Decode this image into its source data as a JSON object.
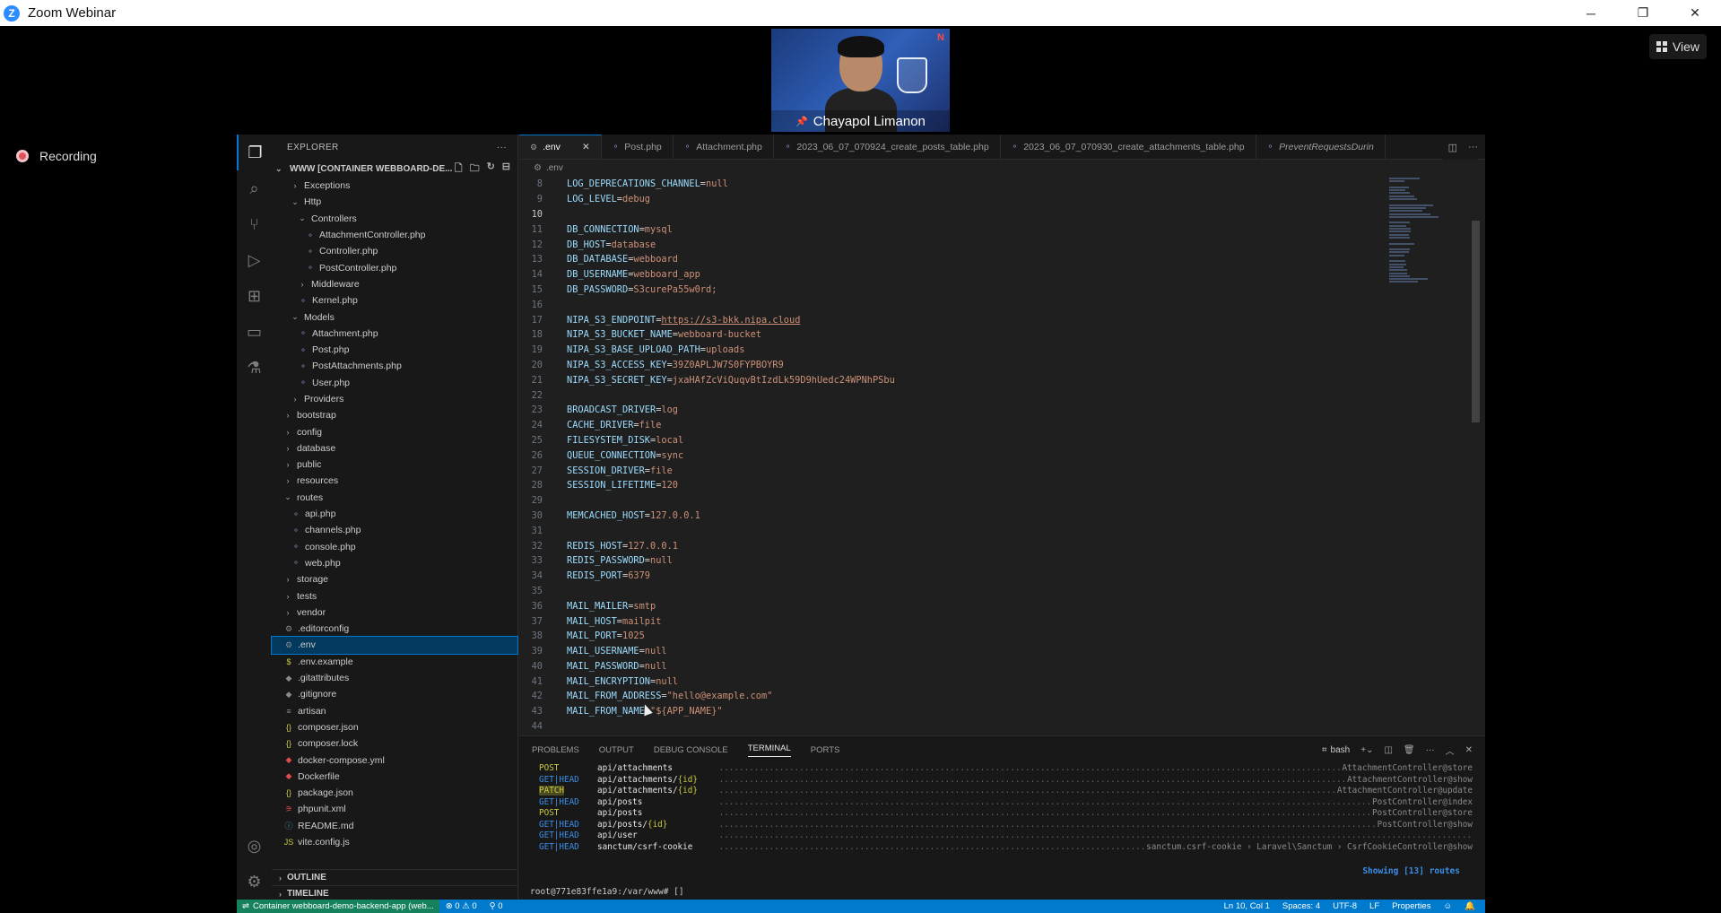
{
  "zoom": {
    "title": "Zoom Webinar",
    "view_label": "View",
    "recording_label": "Recording",
    "participant_name": "Chayapol Limanon"
  },
  "sidebar": {
    "header": "EXPLORER",
    "workspace": "WWW [CONTAINER WEBBOARD-DE...",
    "items": [
      {
        "label": "Exceptions",
        "indent": 2,
        "type": "folder",
        "open": false
      },
      {
        "label": "Http",
        "indent": 2,
        "type": "folder",
        "open": true
      },
      {
        "label": "Controllers",
        "indent": 3,
        "type": "folder",
        "open": true
      },
      {
        "label": "AttachmentController.php",
        "indent": 4,
        "type": "php"
      },
      {
        "label": "Controller.php",
        "indent": 4,
        "type": "php"
      },
      {
        "label": "PostController.php",
        "indent": 4,
        "type": "php"
      },
      {
        "label": "Middleware",
        "indent": 3,
        "type": "folder",
        "open": false
      },
      {
        "label": "Kernel.php",
        "indent": 3,
        "type": "php"
      },
      {
        "label": "Models",
        "indent": 2,
        "type": "folder",
        "open": true
      },
      {
        "label": "Attachment.php",
        "indent": 3,
        "type": "php"
      },
      {
        "label": "Post.php",
        "indent": 3,
        "type": "php"
      },
      {
        "label": "PostAttachments.php",
        "indent": 3,
        "type": "php"
      },
      {
        "label": "User.php",
        "indent": 3,
        "type": "php"
      },
      {
        "label": "Providers",
        "indent": 2,
        "type": "folder",
        "open": false
      },
      {
        "label": "bootstrap",
        "indent": 1,
        "type": "folder",
        "open": false
      },
      {
        "label": "config",
        "indent": 1,
        "type": "folder",
        "open": false
      },
      {
        "label": "database",
        "indent": 1,
        "type": "folder",
        "open": false
      },
      {
        "label": "public",
        "indent": 1,
        "type": "folder",
        "open": false
      },
      {
        "label": "resources",
        "indent": 1,
        "type": "folder",
        "open": false
      },
      {
        "label": "routes",
        "indent": 1,
        "type": "folder",
        "open": true
      },
      {
        "label": "api.php",
        "indent": 2,
        "type": "php"
      },
      {
        "label": "channels.php",
        "indent": 2,
        "type": "php"
      },
      {
        "label": "console.php",
        "indent": 2,
        "type": "php"
      },
      {
        "label": "web.php",
        "indent": 2,
        "type": "php"
      },
      {
        "label": "storage",
        "indent": 1,
        "type": "folder",
        "open": false
      },
      {
        "label": "tests",
        "indent": 1,
        "type": "folder",
        "open": false
      },
      {
        "label": "vendor",
        "indent": 1,
        "type": "folder",
        "open": false
      },
      {
        "label": ".editorconfig",
        "indent": 1,
        "type": "gear"
      },
      {
        "label": ".env",
        "indent": 1,
        "type": "gear",
        "selected": true
      },
      {
        "label": ".env.example",
        "indent": 1,
        "type": "dollar"
      },
      {
        "label": ".gitattributes",
        "indent": 1,
        "type": "git"
      },
      {
        "label": ".gitignore",
        "indent": 1,
        "type": "git"
      },
      {
        "label": "artisan",
        "indent": 1,
        "type": "text"
      },
      {
        "label": "composer.json",
        "indent": 1,
        "type": "json"
      },
      {
        "label": "composer.lock",
        "indent": 1,
        "type": "json"
      },
      {
        "label": "docker-compose.yml",
        "indent": 1,
        "type": "docker"
      },
      {
        "label": "Dockerfile",
        "indent": 1,
        "type": "docker"
      },
      {
        "label": "package.json",
        "indent": 1,
        "type": "json"
      },
      {
        "label": "phpunit.xml",
        "indent": 1,
        "type": "xml"
      },
      {
        "label": "README.md",
        "indent": 1,
        "type": "info"
      },
      {
        "label": "vite.config.js",
        "indent": 1,
        "type": "js"
      }
    ],
    "outline": "OUTLINE",
    "timeline": "TIMELINE"
  },
  "tabs": [
    {
      "label": ".env",
      "active": true
    },
    {
      "label": "Post.php"
    },
    {
      "label": "Attachment.php"
    },
    {
      "label": "2023_06_07_070924_create_posts_table.php"
    },
    {
      "label": "2023_06_07_070930_create_attachments_table.php"
    },
    {
      "label": "PreventRequestsDurin",
      "italic": true
    }
  ],
  "breadcrumb": ".env",
  "code_lines": [
    {
      "n": "8",
      "k": "LOG_DEPRECATIONS_CHANNEL",
      "v": "null"
    },
    {
      "n": "9",
      "k": "LOG_LEVEL",
      "v": "debug"
    },
    {
      "n": "10",
      "k": "",
      "v": ""
    },
    {
      "n": "11",
      "k": "DB_CONNECTION",
      "v": "mysql"
    },
    {
      "n": "12",
      "k": "DB_HOST",
      "v": "database"
    },
    {
      "n": "13",
      "k": "DB_DATABASE",
      "v": "webboard"
    },
    {
      "n": "14",
      "k": "DB_USERNAME",
      "v": "webboard_app"
    },
    {
      "n": "15",
      "k": "DB_PASSWORD",
      "v": "S3curePa55w0rd;"
    },
    {
      "n": "16",
      "k": "",
      "v": ""
    },
    {
      "n": "17",
      "k": "NIPA_S3_ENDPOINT",
      "v": "https://s3-bkk.nipa.cloud",
      "url": true
    },
    {
      "n": "18",
      "k": "NIPA_S3_BUCKET_NAME",
      "v": "webboard-bucket"
    },
    {
      "n": "19",
      "k": "NIPA_S3_BASE_UPLOAD_PATH",
      "v": "uploads"
    },
    {
      "n": "20",
      "k": "NIPA_S3_ACCESS_KEY",
      "v": "39Z0APLJW7S0FYPBOYR9"
    },
    {
      "n": "21",
      "k": "NIPA_S3_SECRET_KEY",
      "v": "jxaHAfZcViQuqvBtIzdLk59D9hUedc24WPNhPSbu"
    },
    {
      "n": "22",
      "k": "",
      "v": ""
    },
    {
      "n": "23",
      "k": "BROADCAST_DRIVER",
      "v": "log"
    },
    {
      "n": "24",
      "k": "CACHE_DRIVER",
      "v": "file"
    },
    {
      "n": "25",
      "k": "FILESYSTEM_DISK",
      "v": "local"
    },
    {
      "n": "26",
      "k": "QUEUE_CONNECTION",
      "v": "sync"
    },
    {
      "n": "27",
      "k": "SESSION_DRIVER",
      "v": "file"
    },
    {
      "n": "28",
      "k": "SESSION_LIFETIME",
      "v": "120"
    },
    {
      "n": "29",
      "k": "",
      "v": ""
    },
    {
      "n": "30",
      "k": "MEMCACHED_HOST",
      "v": "127.0.0.1"
    },
    {
      "n": "31",
      "k": "",
      "v": ""
    },
    {
      "n": "32",
      "k": "REDIS_HOST",
      "v": "127.0.0.1"
    },
    {
      "n": "33",
      "k": "REDIS_PASSWORD",
      "v": "null"
    },
    {
      "n": "34",
      "k": "REDIS_PORT",
      "v": "6379"
    },
    {
      "n": "35",
      "k": "",
      "v": ""
    },
    {
      "n": "36",
      "k": "MAIL_MAILER",
      "v": "smtp"
    },
    {
      "n": "37",
      "k": "MAIL_HOST",
      "v": "mailpit"
    },
    {
      "n": "38",
      "k": "MAIL_PORT",
      "v": "1025"
    },
    {
      "n": "39",
      "k": "MAIL_USERNAME",
      "v": "null"
    },
    {
      "n": "40",
      "k": "MAIL_PASSWORD",
      "v": "null"
    },
    {
      "n": "41",
      "k": "MAIL_ENCRYPTION",
      "v": "null"
    },
    {
      "n": "42",
      "k": "MAIL_FROM_ADDRESS",
      "v": "\"hello@example.com\""
    },
    {
      "n": "43",
      "k": "MAIL_FROM_NAME",
      "v": "\"${APP_NAME}\""
    },
    {
      "n": "44",
      "k": "",
      "v": ""
    }
  ],
  "panel": {
    "tabs": [
      "PROBLEMS",
      "OUTPUT",
      "DEBUG CONSOLE",
      "TERMINAL",
      "PORTS"
    ],
    "active_tab": "TERMINAL",
    "shell": "bash",
    "routes": [
      {
        "method": "POST",
        "kind": "post",
        "path": "api/attachments",
        "param": "",
        "ctrl": "AttachmentController@store"
      },
      {
        "method": "GET|HEAD",
        "kind": "get",
        "path": "api/attachments/",
        "param": "{id}",
        "ctrl": "AttachmentController@show"
      },
      {
        "method": "PATCH",
        "kind": "patch",
        "path": "api/attachments/",
        "param": "{id}",
        "ctrl": "AttachmentController@update"
      },
      {
        "method": "GET|HEAD",
        "kind": "get",
        "path": "api/posts",
        "param": "",
        "ctrl": "PostController@index"
      },
      {
        "method": "POST",
        "kind": "post",
        "path": "api/posts",
        "param": "",
        "ctrl": "PostController@store"
      },
      {
        "method": "GET|HEAD",
        "kind": "get",
        "path": "api/posts/",
        "param": "{id}",
        "ctrl": "PostController@show"
      },
      {
        "method": "GET|HEAD",
        "kind": "get",
        "path": "api/user",
        "param": "",
        "ctrl": ""
      },
      {
        "method": "GET|HEAD",
        "kind": "get",
        "path": "sanctum/csrf-cookie",
        "param": "",
        "ctrl": "sanctum.csrf-cookie › Laravel\\Sanctum › CsrfCookieController@show"
      }
    ],
    "showing": "Showing [13] routes",
    "prompt": "root@771e83ffe1a9:/var/www# []"
  },
  "statusbar": {
    "remote": "Container webboard-demo-backend-app (web...",
    "problems": "⊗ 0 ⚠ 0",
    "ports": "⚲ 0",
    "position": "Ln 10, Col 1",
    "spaces": "Spaces: 4",
    "encoding": "UTF-8",
    "eol": "LF",
    "language": "Properties"
  }
}
